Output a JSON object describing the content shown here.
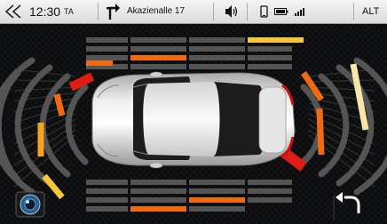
{
  "status_bar": {
    "back_icon": "double-chevron-left-icon",
    "time": "12:30",
    "ta_label": "TA",
    "navigation": {
      "turn_icon": "turn-right-arrow-icon",
      "street": "Akazienalle 17"
    },
    "volume_icon": "speaker-volume-icon",
    "phone_icon": "phone-icon",
    "battery_icon": "battery-icon",
    "signal_icon": "signal-bars-icon",
    "mode_button": "ALT"
  },
  "parking_view": {
    "vehicle": "car-top-view",
    "camera_button_icon": "camera-lens-icon",
    "return_button_icon": "return-arrow-icon",
    "colors": {
      "background": "#0b0c0d",
      "grid": "#2f2f2f",
      "off": "#545454",
      "red": "#e01c14",
      "orange": "#f06a14",
      "amber": "#f5a21e",
      "yellow": "#f7c63a",
      "pale": "#f7e6a8"
    }
  }
}
